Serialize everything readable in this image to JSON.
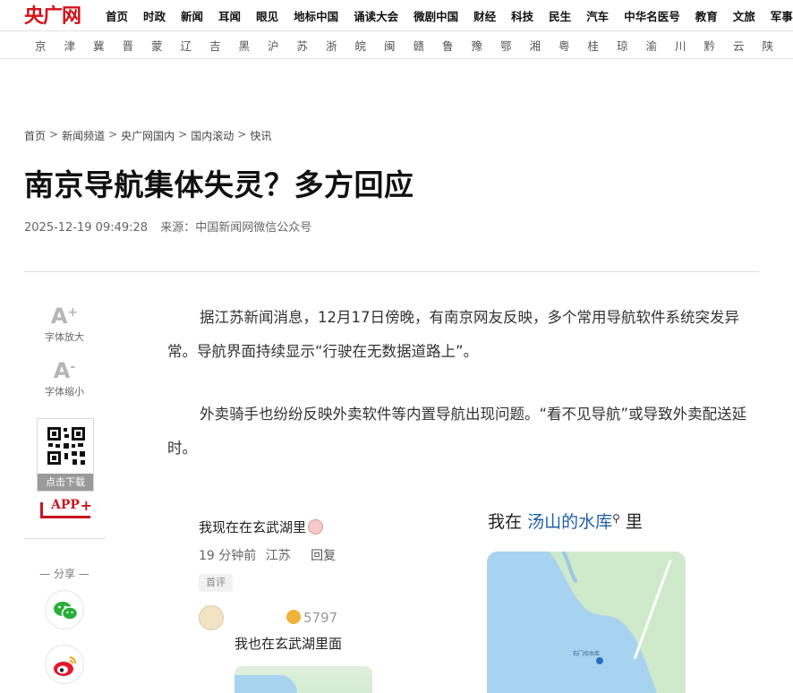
{
  "brand": {
    "logo_text": "央广网",
    "accent": "#d5101a"
  },
  "nav": {
    "items": [
      "首页",
      "时政",
      "新闻",
      "耳闻",
      "眼见",
      "地标中国",
      "诵读大会",
      "微剧中国",
      "财经",
      "科技",
      "民生",
      "汽车",
      "中华名医号",
      "教育",
      "文旅",
      "军事"
    ]
  },
  "provinces": {
    "items": [
      "京",
      "津",
      "冀",
      "晋",
      "蒙",
      "辽",
      "吉",
      "黑",
      "沪",
      "苏",
      "浙",
      "皖",
      "闽",
      "赣",
      "鲁",
      "豫",
      "鄂",
      "湘",
      "粤",
      "桂",
      "琼",
      "渝",
      "川",
      "黔",
      "云",
      "陕"
    ]
  },
  "breadcrumb": {
    "items": [
      "首页",
      "新闻频道",
      "央广网国内",
      "国内滚动",
      "快讯"
    ],
    "separator": ">"
  },
  "article": {
    "title": "南京导航集体失灵？多方回应",
    "datetime": "2025-12-19 09:49:28",
    "source_label": "来源：",
    "source": "中国新闻网微信公众号",
    "paragraphs": [
      "据江苏新闻消息，12月17日傍晚，有南京网友反映，多个常用导航软件系统突发异常。导航界面持续显示“行驶在无数据道路上”。",
      "外卖骑手也纷纷反映外卖软件等内置导航出现问题。“看不见导航”或导致外卖配送延时。"
    ]
  },
  "tools": {
    "font_increase_glyph": "A",
    "font_increase_sup": "+",
    "font_increase_label": "字体放大",
    "font_decrease_glyph": "A",
    "font_decrease_sup": "-",
    "font_decrease_label": "字体缩小",
    "qr_caption": "点击下载",
    "app_label": "APP",
    "app_plus": "+",
    "share_label": "— 分享 —",
    "share_icons": [
      "wechat-icon",
      "weibo-icon"
    ],
    "share_colors": {
      "wechat": "#2aae3b",
      "weibo": "#e6162d"
    }
  },
  "embedded_image": {
    "left_comment": {
      "text": "我现在在玄武湖里",
      "time": "19 分钟前",
      "location": "江苏",
      "reply_label": "回复",
      "tag": "首评",
      "likes": "5797",
      "reply_text": "我也在玄武湖里面"
    },
    "right_post": {
      "prefix": "我在",
      "place": "汤山的水库",
      "suffix": "里",
      "map_label": "石门坎水库"
    }
  }
}
